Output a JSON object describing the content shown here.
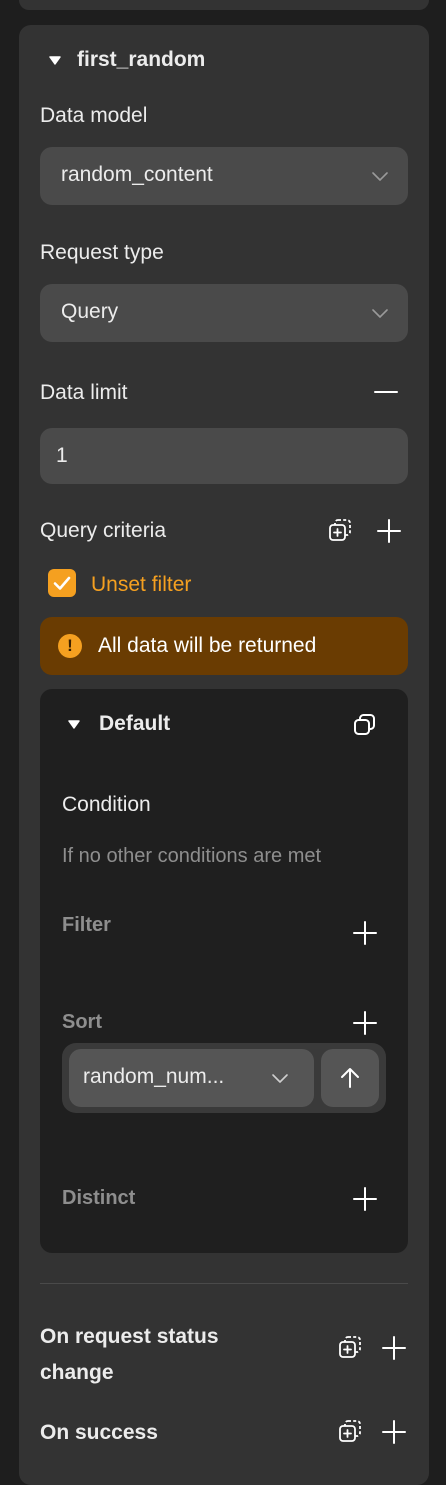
{
  "section": {
    "title": "first_random",
    "data_model_label": "Data model",
    "data_model_value": "random_content",
    "request_type_label": "Request type",
    "request_type_value": "Query",
    "data_limit_label": "Data limit",
    "data_limit_value": "1",
    "query_criteria_label": "Query criteria",
    "unset_filter_label": "Unset filter",
    "unset_filter_checked": true,
    "warning_text": "All data will be returned",
    "warning_color": "#6a3c02",
    "accent_color": "#f5a020"
  },
  "default_block": {
    "title": "Default",
    "condition_label": "Condition",
    "condition_hint": "If no other conditions are met",
    "filter_label": "Filter",
    "sort_label": "Sort",
    "sort_field_value": "random_num...",
    "sort_direction_icon": "arrow-up-icon",
    "distinct_label": "Distinct"
  },
  "events": {
    "on_request_status_change_line1": "On request status",
    "on_request_status_change_line2": "change",
    "on_success_label": "On success"
  }
}
